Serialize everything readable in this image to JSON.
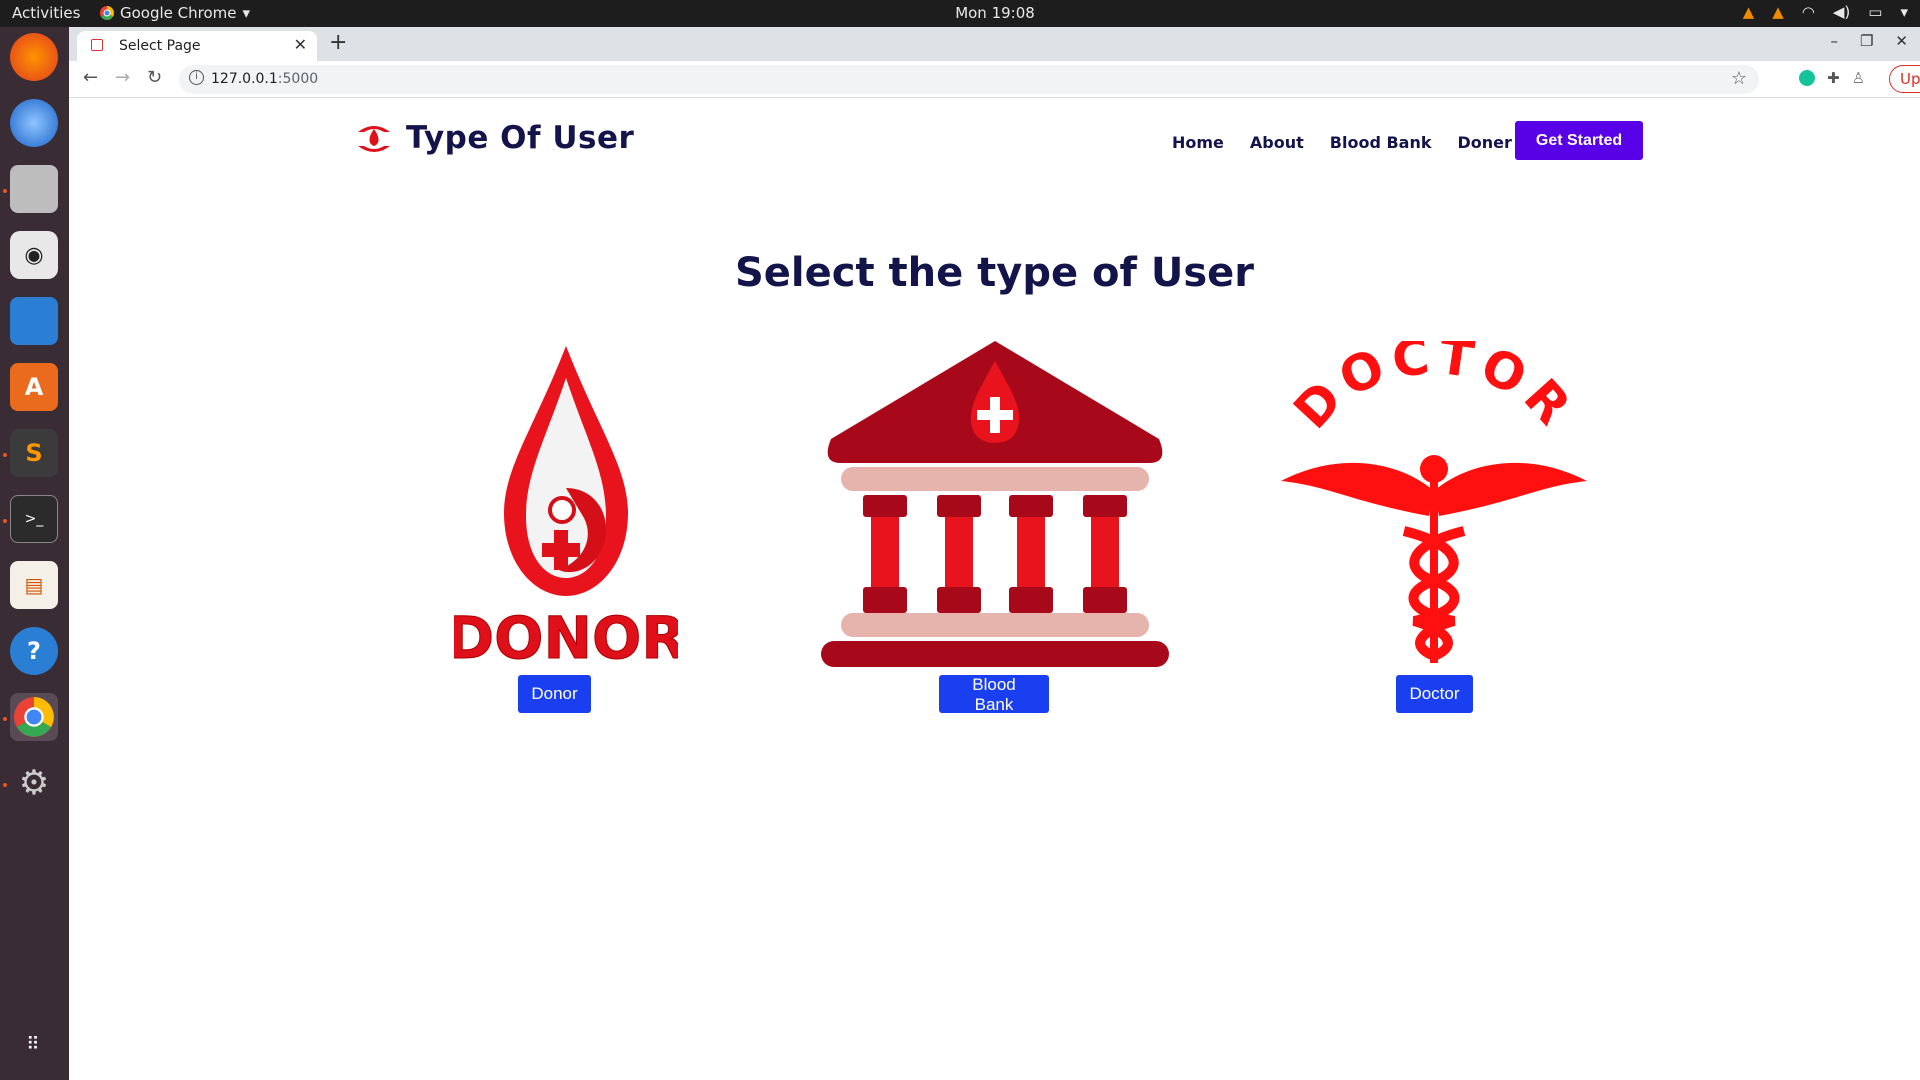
{
  "system_bar": {
    "activities": "Activities",
    "app_name": "Google Chrome",
    "clock": "Mon 19:08"
  },
  "browser": {
    "tab_title": "Select Page",
    "url_host": "127.0.0.1",
    "url_port": ":5000",
    "update_label": "Update"
  },
  "site": {
    "brand": "Type Of User",
    "nav": [
      "Home",
      "About",
      "Blood Bank",
      "Doner"
    ],
    "cta": "Get Started",
    "heading": "Select the type of User",
    "cards": [
      {
        "image_text": "DONOR",
        "button": "Donor"
      },
      {
        "image_text": "",
        "button": "Blood Bank"
      },
      {
        "image_text": "DOCTOR",
        "button": "Doctor"
      }
    ]
  },
  "colors": {
    "brand_navy": "#13144a",
    "cta_purple": "#5800e6",
    "button_blue": "#1a3ff0",
    "blood_red": "#e0101a"
  }
}
